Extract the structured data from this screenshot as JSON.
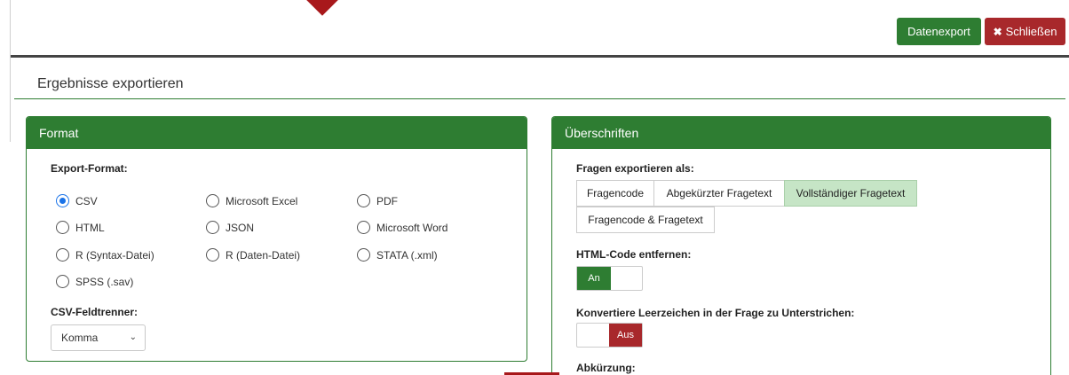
{
  "toolbar": {
    "export_label": "Datenexport",
    "close_label": "Schließen",
    "close_icon": "✖"
  },
  "page": {
    "title": "Ergebnisse exportieren"
  },
  "format_panel": {
    "header": "Format",
    "export_format_label": "Export-Format:",
    "options": {
      "csv": "CSV",
      "excel": "Microsoft Excel",
      "pdf": "PDF",
      "html": "HTML",
      "json": "JSON",
      "word": "Microsoft Word",
      "r_syntax": "R (Syntax-Datei)",
      "r_data": "R (Daten-Datei)",
      "stata": "STATA (.xml)",
      "spss": "SPSS (.sav)"
    },
    "selected": "CSV",
    "separator_label": "CSV-Feldtrenner:",
    "separator_value": "Komma"
  },
  "headings_panel": {
    "header": "Überschriften",
    "export_as_label": "Fragen exportieren als:",
    "export_as_options": {
      "code": "Fragencode",
      "abbrev": "Abgekürzter Fragetext",
      "full": "Vollständiger Fragetext",
      "code_text": "Fragencode & Fragetext"
    },
    "export_as_selected": "Vollständiger Fragetext",
    "strip_html_label": "HTML-Code entfernen:",
    "strip_html_state": "An",
    "convert_spaces_label": "Konvertiere Leerzeichen in der Frage zu Unterstrichen:",
    "convert_spaces_state": "Aus",
    "abbreviation_label": "Abkürzung:"
  },
  "colors": {
    "primary_green": "#2e7d32",
    "danger_red": "#a8282b",
    "active_segment": "#c6e5c6",
    "radio_blue": "#1a73e8"
  }
}
